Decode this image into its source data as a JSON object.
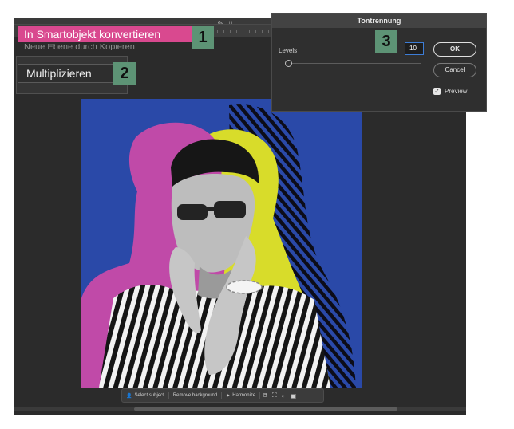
{
  "context_menu": {
    "highlighted_item": "In Smartobjekt konvertieren",
    "next_item_partial": "Neue Ebene durch Kopieren",
    "badge": "1"
  },
  "blend_mode": {
    "label": "Multiplizieren",
    "badge": "2"
  },
  "dialog": {
    "title": "Tontrennung",
    "levels_label": "Levels",
    "levels_value": "10",
    "ok_label": "OK",
    "cancel_label": "Cancel",
    "preview_label": "Preview",
    "preview_checked": true,
    "badge": "3"
  },
  "taskbar": {
    "select_subject": "Select subject",
    "remove_background": "Remove background",
    "harmonize": "Harmonize",
    "more": "⋯"
  },
  "colors": {
    "canvas_background": "#2a49a8",
    "magenta_copy": "#c04aa8",
    "yellow_copy": "#d8dc2a",
    "menu_highlight": "#d9498f",
    "badge_green": "#5d9375"
  }
}
